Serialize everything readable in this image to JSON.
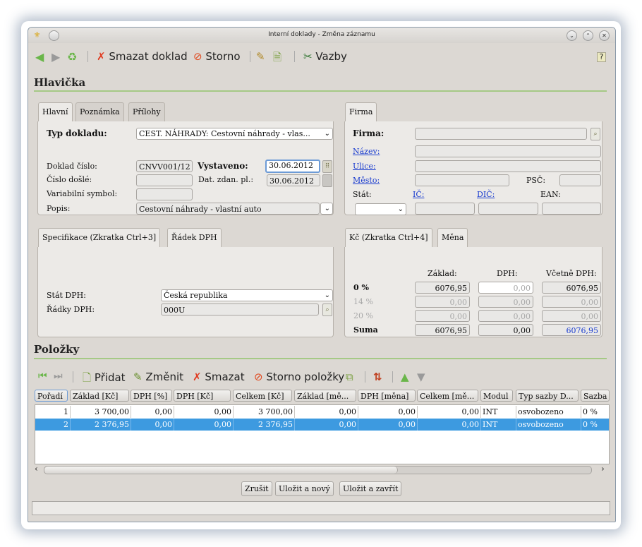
{
  "window": {
    "title": "Interní doklady - Změna záznamu"
  },
  "toolbar": {
    "delete_label": "Smazat doklad",
    "storno_label": "Storno",
    "links_label": "Vazby"
  },
  "header": {
    "section_title": "Hlavička",
    "tabs_left": [
      "Hlavní",
      "Poznámka",
      "Přílohy"
    ],
    "tab_firm": "Firma",
    "typ_label": "Typ dokladu:",
    "typ_value": "CEST. NÁHRADY: Cestovní náhrady - vlas...",
    "doklad_label": "Doklad číslo:",
    "doklad_value": "CNVV001/12",
    "vystaveno_label": "Vystaveno:",
    "vystaveno_value": "30.06.2012",
    "cislo_dosle_label": "Číslo došlé:",
    "dat_zdan_label": "Dat. zdan. pl.:",
    "dat_zdan_value": "30.06.2012",
    "var_symbol_label": "Variabilní symbol:",
    "popis_label": "Popis:",
    "popis_value": "Cestovní náhrady - vlastní auto",
    "firm": {
      "firma_label": "Firma:",
      "nazev_label": "Název:",
      "ulice_label": "Ulice:",
      "mesto_label": "Město:",
      "psc_label": "PSČ:",
      "stat_label": "Stát:",
      "ic_label": "IČ:",
      "dic_label": "DIČ:",
      "ean_label": "EAN:"
    }
  },
  "spec": {
    "tabs": [
      "Specifikace (Zkratka Ctrl+3]",
      "Řádek DPH"
    ],
    "stat_dph_label": "Stát DPH:",
    "stat_dph_value": "Česká republika",
    "radky_dph_label": "Řádky DPH:",
    "radky_dph_value": "000U"
  },
  "kc": {
    "tabs": [
      "Kč (Zkratka Ctrl+4]",
      "Měna"
    ],
    "col_zaklad": "Základ:",
    "col_dph": "DPH:",
    "col_vcetne": "Včetně DPH:",
    "rows": [
      {
        "label": "0 %",
        "zaklad": "6076,95",
        "dph": "0,00",
        "vcetne": "6076,95"
      },
      {
        "label": "14 %",
        "zaklad": "0,00",
        "dph": "0,00",
        "vcetne": "0,00"
      },
      {
        "label": "20 %",
        "zaklad": "0,00",
        "dph": "0,00",
        "vcetne": "0,00"
      }
    ],
    "suma_label": "Suma",
    "suma_zaklad": "6076,95",
    "suma_dph": "0,00",
    "suma_vcetne": "6076,95"
  },
  "items": {
    "section_title": "Položky",
    "add_label": "Přidat",
    "edit_label": "Změnit",
    "delete_label": "Smazat",
    "storno_label": "Storno položky",
    "columns": [
      "Pořadí",
      "Základ [Kč]",
      "DPH [%]",
      "DPH [Kč]",
      "Celkem [Kč]",
      "Základ [mě...",
      "DPH [měna]",
      "Celkem [mě...",
      "Modul",
      "Typ sazby D...",
      "Sazba"
    ],
    "rows": [
      [
        "1",
        "3 700,00",
        "0,00",
        "0,00",
        "3 700,00",
        "0,00",
        "0,00",
        "0,00",
        "INT",
        "osvobozeno",
        "0 %"
      ],
      [
        "2",
        "2 376,95",
        "0,00",
        "0,00",
        "2 376,95",
        "0,00",
        "0,00",
        "0,00",
        "INT",
        "osvobozeno",
        "0 %"
      ]
    ],
    "selected_row": 1
  },
  "footer": {
    "cancel_label": "Zrušit",
    "save_new_label": "Uložit a nový",
    "save_close_label": "Uložit a zavřít"
  },
  "colors": {
    "accent_line": "#a5c985",
    "selection": "#3d9ae0",
    "link": "#1a3ccf"
  }
}
